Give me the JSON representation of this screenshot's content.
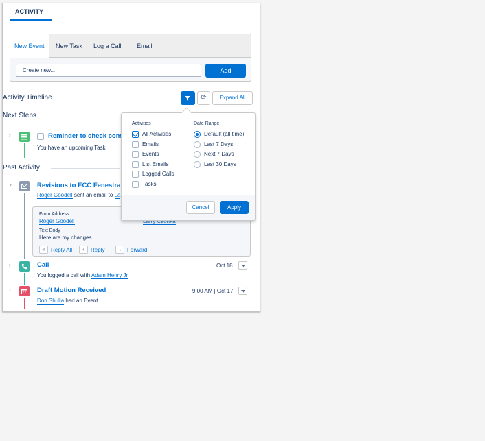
{
  "panel": {
    "tab_label": "ACTIVITY"
  },
  "composer": {
    "tabs": [
      {
        "label": "New Event"
      },
      {
        "label": "New Task"
      },
      {
        "label": "Log a Call"
      },
      {
        "label": "Email"
      }
    ],
    "active_tab": "New Event",
    "input_value": "Create new...",
    "add_label": "Add"
  },
  "timeline": {
    "title": "Activity Timeline",
    "expand_label": "Expand All"
  },
  "next_steps": {
    "title": "Next Steps",
    "task_title": "Reminder to check comp",
    "task_sub": "You have an upcoming Task"
  },
  "past_activity": {
    "title": "Past Activity",
    "email": {
      "title": "Revisions to ECC Fenestration",
      "sender": "Roger Goodell",
      "sub_text": "sent an email to",
      "recipient_fragment": "La",
      "from_label": "From Address",
      "from_value": "Roger Goodell",
      "to_value": "Larry Csonka",
      "body_label": "Text Body",
      "body_value": "Here are my changes.",
      "actions": [
        {
          "label": "Reply All",
          "icon": "reply-all-icon"
        },
        {
          "label": "Reply",
          "icon": "reply-icon"
        },
        {
          "label": "Forward",
          "icon": "forward-icon"
        }
      ]
    },
    "call": {
      "title": "Call",
      "sub_text": "You logged a call with",
      "contact": "Adam Henry Jr",
      "date": "Oct 18"
    },
    "event": {
      "title": "Draft Motion Received",
      "contact": "Don Shulla",
      "sub_text": "had an Event",
      "date": "9:00 AM | Oct 17"
    }
  },
  "filter_dropdown": {
    "activities_heading": "Activities",
    "date_heading": "Date Range",
    "activities": [
      {
        "label": "All Activities",
        "checked": true
      },
      {
        "label": "Emails",
        "checked": false
      },
      {
        "label": "Events",
        "checked": false
      },
      {
        "label": "List Emails",
        "checked": false
      },
      {
        "label": "Logged Calls",
        "checked": false
      },
      {
        "label": "Tasks",
        "checked": false
      }
    ],
    "date_ranges": [
      {
        "label": "Default (all time)",
        "checked": true
      },
      {
        "label": "Last 7 Days",
        "checked": false
      },
      {
        "label": "Next 7 Days",
        "checked": false
      },
      {
        "label": "Last 30 Days",
        "checked": false
      }
    ],
    "cancel_label": "Cancel",
    "apply_label": "Apply"
  },
  "colors": {
    "brand_blue": "#0070d2",
    "task_green": "#4bc076",
    "email_slate": "#8b9aae",
    "call_teal": "#3bb3a4",
    "event_red": "#e4526a",
    "text_navy": "#16325c"
  },
  "icons": [
    "filter-icon",
    "refresh-icon",
    "task-icon",
    "email-icon",
    "call-icon",
    "event-icon",
    "chevron-right-icon",
    "chevron-down-icon"
  ]
}
